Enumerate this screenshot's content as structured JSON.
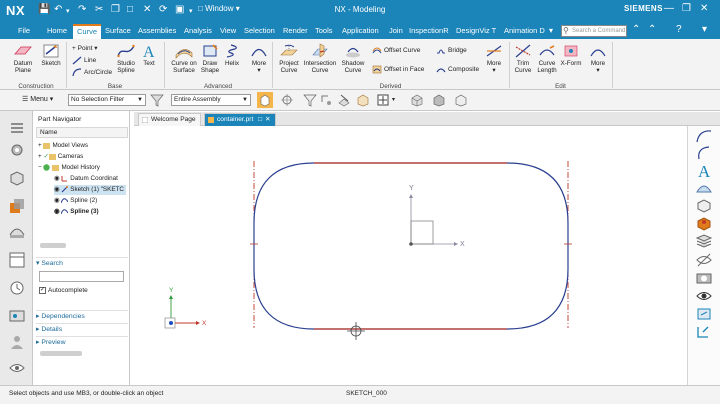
{
  "titlebar": {
    "logo": "NX",
    "window_menu": "Window",
    "title": "NX - Modeling",
    "brand": "SIEMENS"
  },
  "tabs": [
    {
      "label": "File"
    },
    {
      "label": "Home"
    },
    {
      "label": "Curve"
    },
    {
      "label": "Surface"
    },
    {
      "label": "Assemblies"
    },
    {
      "label": "Analysis"
    },
    {
      "label": "View"
    },
    {
      "label": "Selection"
    },
    {
      "label": "Render"
    },
    {
      "label": "Tools"
    },
    {
      "label": "Application"
    },
    {
      "label": "Join"
    },
    {
      "label": "InspectionR"
    },
    {
      "label": "DesignViz T"
    },
    {
      "label": "Animation D"
    }
  ],
  "active_tab": "Curve",
  "search_command": {
    "placeholder": "Search a Command"
  },
  "ribbon": {
    "datum_plane": "Datum Plane",
    "sketch": "Sketch",
    "point": "Point",
    "line": "Line",
    "arc_circle": "Arc/Circle",
    "studio_spline": "Studio Spline",
    "text": "Text",
    "curve_on_surface": "Curve on Surface",
    "draw_shape": "Draw Shape",
    "helix": "Helix",
    "more": "More",
    "project_curve": "Project Curve",
    "intersection_curve": "Intersection Curve",
    "shadow_curve": "Shadow Curve",
    "offset_curve": "Offset Curve",
    "bridge": "Bridge",
    "offset_in_face": "Offset in Face",
    "composite": "Composite",
    "trim_curve": "Trim Curve",
    "curve_length": "Curve Length",
    "x_form": "X-Form",
    "groups": {
      "construction": "Construction",
      "base": "Base",
      "advanced": "Advanced",
      "derived": "Derived",
      "edit": "Edit"
    }
  },
  "selection_bar": {
    "menu": "Menu",
    "filter": "No Selection Filter",
    "scope": "Entire Assembly"
  },
  "navigator": {
    "title": "Part Navigator",
    "column": "Name",
    "items": [
      {
        "label": "Model Views"
      },
      {
        "label": "Cameras"
      },
      {
        "label": "Model History"
      },
      {
        "label": "Datum Coordinat"
      },
      {
        "label": "Sketch (1) \"SKETC"
      },
      {
        "label": "Spline (2)"
      },
      {
        "label": "Spline (3)"
      }
    ],
    "search_label": "Search",
    "autocomplete": "Autocomplete",
    "dependencies": "Dependencies",
    "details": "Details",
    "preview": "Preview"
  },
  "graphics_tabs": [
    {
      "label": "Welcome Page"
    },
    {
      "label": "container.prt"
    }
  ],
  "axes": {
    "x": "X",
    "y": "Y"
  },
  "status": {
    "message": "Select objects and use MB3, or double-click an object",
    "sketch": "SKETCH_000"
  },
  "colors": {
    "accent": "#1b84b8",
    "curve": "#2a3f8f",
    "constraint": "#c0392b",
    "active_tab_underline": "#e07b1b"
  }
}
